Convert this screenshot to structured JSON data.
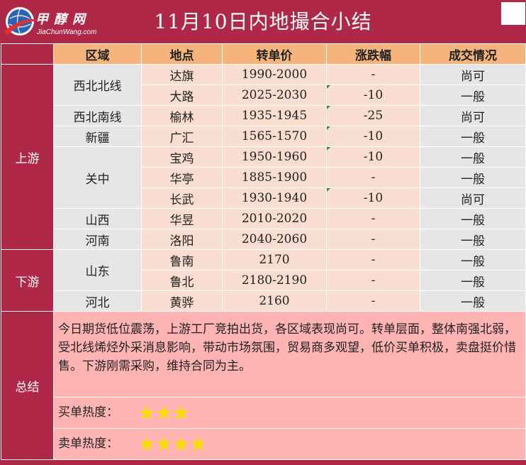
{
  "logo": {
    "cn": "甲醇网",
    "en": "JiaChunWang.com",
    "colors": {
      "globe_blue": "#2a63b8",
      "swoosh_red": "#e03030"
    }
  },
  "title": "11月10日内地撮合小结",
  "columns": [
    "区域",
    "地点",
    "转单价",
    "涨跌幅",
    "成交情况"
  ],
  "sections": {
    "upstream": "上游",
    "downstream": "下游",
    "summary": "总结"
  },
  "rows": [
    {
      "region": "西北北线",
      "place": "达旗",
      "price": "1990-2000",
      "change": "-",
      "deal": "尚可"
    },
    {
      "region": "西北北线",
      "place": "大路",
      "price": "2025-2030",
      "change": "-10",
      "deal": "一般"
    },
    {
      "region": "西北南线",
      "place": "榆林",
      "price": "1935-1945",
      "change": "-25",
      "deal": "尚可"
    },
    {
      "region": "新疆",
      "place": "广汇",
      "price": "1565-1570",
      "change": "-10",
      "deal": "一般"
    },
    {
      "region": "关中",
      "place": "宝鸡",
      "price": "1950-1960",
      "change": "-10",
      "deal": "一般"
    },
    {
      "region": "关中",
      "place": "华亭",
      "price": "1885-1900",
      "change": "-",
      "deal": "一般"
    },
    {
      "region": "关中",
      "place": "长武",
      "price": "1930-1940",
      "change": "-10",
      "deal": "尚可"
    },
    {
      "region": "山西",
      "place": "华昱",
      "price": "2010-2020",
      "change": "-",
      "deal": "一般"
    },
    {
      "region": "河南",
      "place": "洛阳",
      "price": "2040-2060",
      "change": "-",
      "deal": "一般"
    },
    {
      "region": "山东",
      "place": "鲁南",
      "price": "2170",
      "change": "-",
      "deal": "一般"
    },
    {
      "region": "山东",
      "place": "鲁北",
      "price": "2180-2190",
      "change": "-",
      "deal": "一般"
    },
    {
      "region": "河北",
      "place": "黄骅",
      "price": "2160",
      "change": "-",
      "deal": "一般"
    }
  ],
  "summary": {
    "text": "今日期货低位震荡，上游工厂竞拍出货，各区域表现尚可。转单层面，整体南强北弱，受北线烯烃外采消息影响，带动市场氛围，贸易商多观望，低价买单积极，卖盘挺价惜售。下游刚需采购，维持合同为主。",
    "buy_heat_label": "买单热度：",
    "buy_heat_stars": 3,
    "sell_heat_label": "卖单热度：",
    "sell_heat_stars": 4
  },
  "colors": {
    "accent": "#b02848",
    "header_orange": "#f4b47c",
    "summary_pink": "#ffb3b3",
    "star_yellow": "#f5e000",
    "change_marker_green": "#2e8b2e"
  }
}
